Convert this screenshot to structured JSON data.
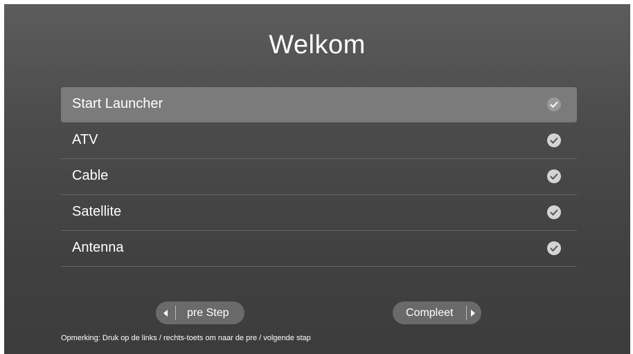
{
  "title": "Welkom",
  "menu": {
    "items": [
      {
        "label": "Start Launcher",
        "selected": true,
        "icon": "check-circle-icon"
      },
      {
        "label": "ATV",
        "selected": false,
        "icon": "check-circle-icon"
      },
      {
        "label": "Cable",
        "selected": false,
        "icon": "check-circle-icon"
      },
      {
        "label": "Satellite",
        "selected": false,
        "icon": "check-circle-icon"
      },
      {
        "label": "Antenna",
        "selected": false,
        "icon": "check-circle-icon"
      }
    ]
  },
  "nav": {
    "prev_label": "pre Step",
    "prev_icon": "arrow-left-icon",
    "next_label": "Compleet",
    "next_icon": "arrow-right-icon"
  },
  "hint": "Opmerking: Druk op de links / rechts-toets om naar de pre / volgende stap",
  "colors": {
    "background": "#4b4b4b",
    "selected_row": "#7b7b7b",
    "button": "#6a6a6a",
    "check": "#d4d4d4"
  }
}
